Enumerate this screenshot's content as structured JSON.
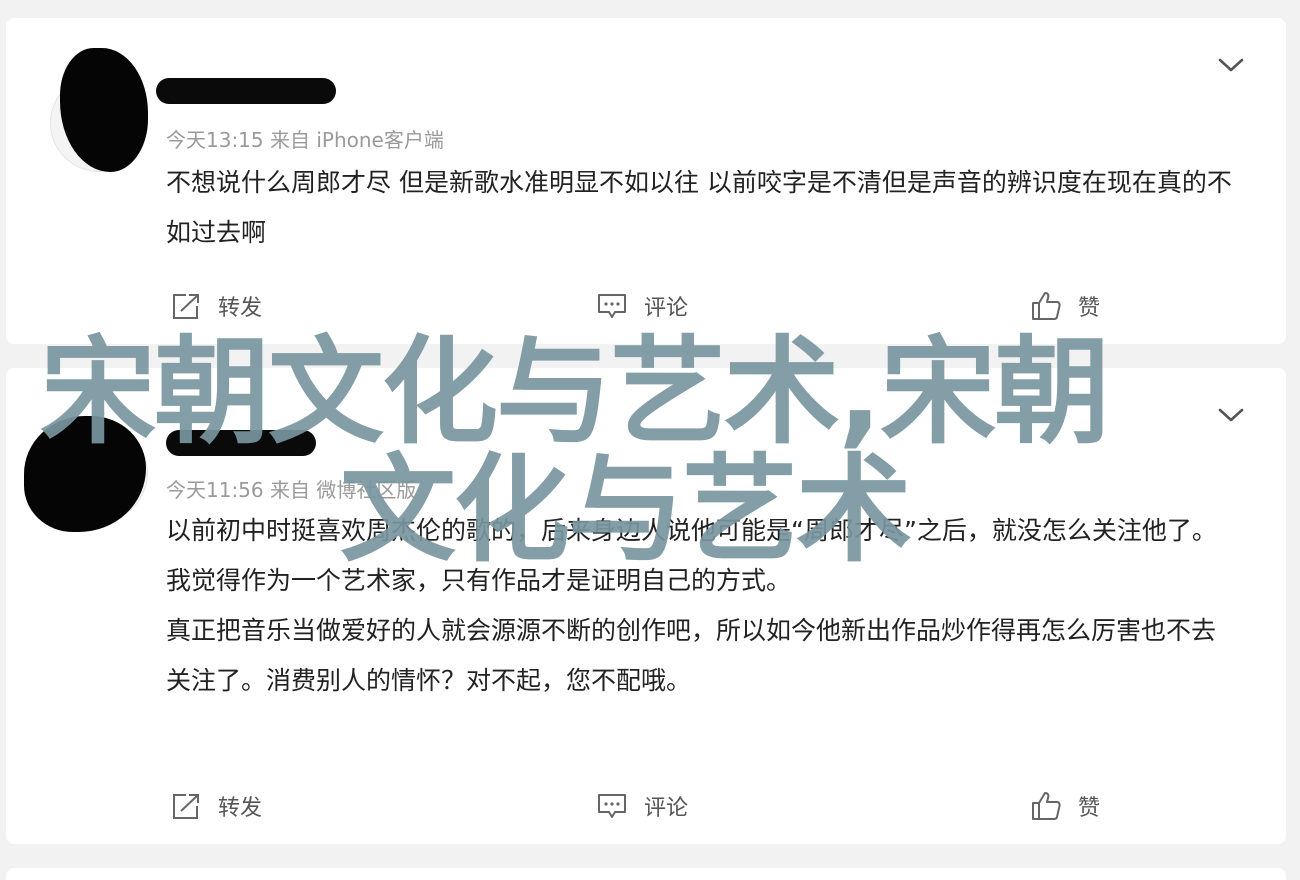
{
  "posts": [
    {
      "meta": "今天13:15  来自 iPhone客户端",
      "body": [
        "不想说什么周郎才尽 但是新歌水准明显不如以往 以前咬字是不清但是声音的辨识度在现在真的不如过去啊"
      ],
      "actions": {
        "repost": "转发",
        "comment": "评论",
        "like": "赞"
      }
    },
    {
      "meta": "今天11:56  来自 微博社区版",
      "body": [
        "以前初中时挺喜欢周杰伦的歌的，后来身边人说他可能是“周郎才尽”之后，就没怎么关注他了。",
        "我觉得作为一个艺术家，只有作品才是证明自己的方式。",
        "真正把音乐当做爱好的人就会源源不断的创作吧，所以如今他新出作品炒作得再怎么厉害也不去关注了。消费别人的情怀？对不起，您不配哦。"
      ],
      "actions": {
        "repost": "转发",
        "comment": "评论",
        "like": "赞"
      }
    }
  ],
  "watermark": {
    "line1": "宋朝文化与艺术,宋朝",
    "line2": "文化与艺术"
  }
}
